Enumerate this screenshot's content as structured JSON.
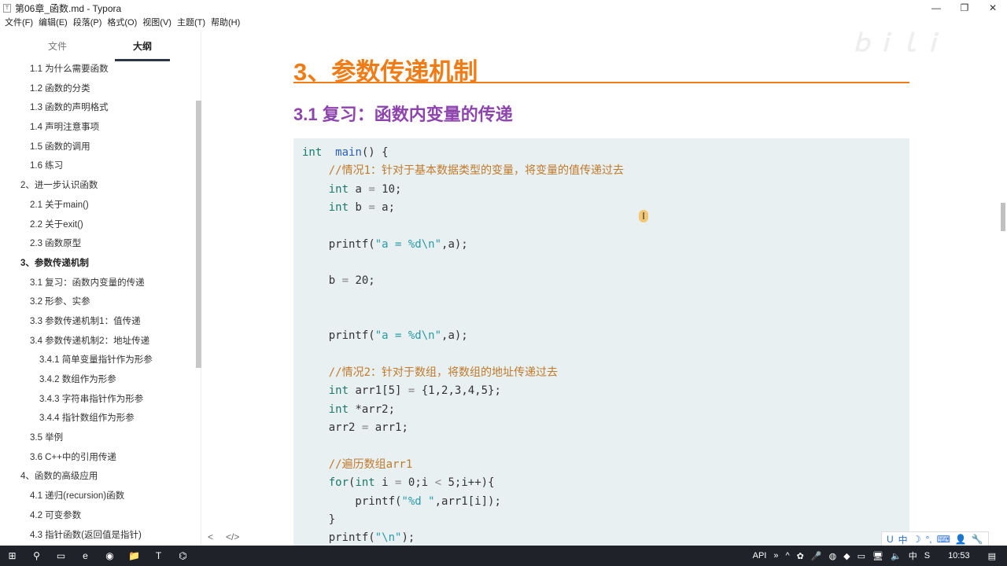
{
  "window": {
    "title": "第06章_函数.md - Typora",
    "icon": "T",
    "minimize": "—",
    "restore": "❐",
    "close": "✕"
  },
  "menu": [
    "文件(F)",
    "编辑(E)",
    "段落(P)",
    "格式(O)",
    "视图(V)",
    "主题(T)",
    "帮助(H)"
  ],
  "sidebar": {
    "tabs": [
      "文件",
      "大纲"
    ],
    "active_tab": "大纲",
    "items": [
      {
        "label": "1.1 为什么需要函数",
        "level": 2
      },
      {
        "label": "1.2 函数的分类",
        "level": 2
      },
      {
        "label": "1.3 函数的声明格式",
        "level": 2
      },
      {
        "label": "1.4 声明注意事项",
        "level": 2
      },
      {
        "label": "1.5 函数的调用",
        "level": 2
      },
      {
        "label": "1.6 练习",
        "level": 2
      },
      {
        "label": "2、进一步认识函数",
        "level": 1
      },
      {
        "label": "2.1 关于main()",
        "level": 2
      },
      {
        "label": "2.2 关于exit()",
        "level": 2
      },
      {
        "label": "2.3 函数原型",
        "level": 2
      },
      {
        "label": "3、参数传递机制",
        "level": 1,
        "active": true
      },
      {
        "label": "3.1 复习：函数内变量的传递",
        "level": 2
      },
      {
        "label": "3.2 形参、实参",
        "level": 2
      },
      {
        "label": "3.3 参数传递机制1：值传递",
        "level": 2
      },
      {
        "label": "3.4 参数传递机制2：地址传递",
        "level": 2
      },
      {
        "label": "3.4.1 简单变量指针作为形参",
        "level": 3
      },
      {
        "label": "3.4.2 数组作为形参",
        "level": 3
      },
      {
        "label": "3.4.3 字符串指针作为形参",
        "level": 3
      },
      {
        "label": "3.4.4 指针数组作为形参",
        "level": 3
      },
      {
        "label": "3.5 举例",
        "level": 2
      },
      {
        "label": "3.6 C++中的引用传递",
        "level": 2
      },
      {
        "label": "4、函数的高级应用",
        "level": 1
      },
      {
        "label": "4.1 递归(recursion)函数",
        "level": 2
      },
      {
        "label": "4.2 可变参数",
        "level": 2
      },
      {
        "label": "4.3 指针函数(返回值是指针)",
        "level": 2
      }
    ],
    "footer": [
      "<",
      "</>"
    ]
  },
  "doc": {
    "h1": "3、参数传递机制",
    "h2": "3.1 复习：函数内变量的传递",
    "code": [
      [
        [
          "kw",
          "int"
        ],
        [
          "",
          "  "
        ],
        [
          "fn",
          "main"
        ],
        [
          "",
          "() {"
        ]
      ],
      [
        [
          "",
          "    "
        ],
        [
          "cm",
          "//情况1：针对于基本数据类型的变量，将变量的值传递过去"
        ]
      ],
      [
        [
          "",
          "    "
        ],
        [
          "kw",
          "int"
        ],
        [
          "",
          " a "
        ],
        [
          "op",
          "="
        ],
        [
          "",
          " 10;"
        ]
      ],
      [
        [
          "",
          "    "
        ],
        [
          "kw",
          "int"
        ],
        [
          "",
          " b "
        ],
        [
          "op",
          "="
        ],
        [
          "",
          " a;"
        ]
      ],
      [],
      [
        [
          "",
          "    printf("
        ],
        [
          "str",
          "\"a = %d\\n\""
        ],
        [
          "",
          ",a);"
        ]
      ],
      [],
      [
        [
          "",
          "    b "
        ],
        [
          "op",
          "="
        ],
        [
          "",
          " 20;"
        ]
      ],
      [],
      [],
      [
        [
          "",
          "    printf("
        ],
        [
          "str",
          "\"a = %d\\n\""
        ],
        [
          "",
          ",a);"
        ]
      ],
      [],
      [
        [
          "",
          "    "
        ],
        [
          "cm",
          "//情况2：针对于数组，将数组的地址传递过去"
        ]
      ],
      [
        [
          "",
          "    "
        ],
        [
          "kw",
          "int"
        ],
        [
          "",
          " arr1[5] "
        ],
        [
          "op",
          "="
        ],
        [
          "",
          " {1,2,3,4,5};"
        ]
      ],
      [
        [
          "",
          "    "
        ],
        [
          "kw",
          "int"
        ],
        [
          "",
          " *arr2;"
        ]
      ],
      [
        [
          "",
          "    arr2 "
        ],
        [
          "op",
          "="
        ],
        [
          "",
          " arr1;"
        ]
      ],
      [],
      [
        [
          "",
          "    "
        ],
        [
          "cm",
          "//遍历数组arr1"
        ]
      ],
      [
        [
          "",
          "    "
        ],
        [
          "kw",
          "for"
        ],
        [
          "",
          "("
        ],
        [
          "kw",
          "int"
        ],
        [
          "",
          " i "
        ],
        [
          "op",
          "="
        ],
        [
          "",
          " 0;i "
        ],
        [
          "op",
          "<"
        ],
        [
          "",
          " 5;i++){"
        ]
      ],
      [
        [
          "",
          "        printf("
        ],
        [
          "str",
          "\"%d \""
        ],
        [
          "",
          ",arr1[i]);"
        ]
      ],
      [
        [
          "",
          "    }"
        ]
      ],
      [
        [
          "",
          "    printf("
        ],
        [
          "str",
          "\"\\n\""
        ],
        [
          "",
          ");"
        ]
      ]
    ]
  },
  "watermark": "bilibili",
  "ime": [
    "U",
    "中",
    "☽",
    "°,",
    "⌨",
    "👤",
    "🔧"
  ],
  "taskbar": {
    "apps": [
      "⊞",
      "⚲",
      "▭",
      "e",
      "◉",
      "📁",
      "T",
      "⌬"
    ],
    "tray": [
      "API",
      "»",
      "^",
      "✿",
      "🎤",
      "◍",
      "◆",
      "▭",
      "🖥",
      "🔈",
      "中",
      "S"
    ],
    "time": "10:53",
    "notif": "▤"
  }
}
